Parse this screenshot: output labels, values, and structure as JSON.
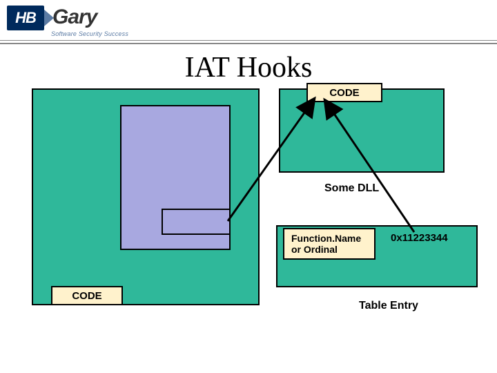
{
  "logo": {
    "hb": "HB",
    "gary": "Gary",
    "tagline": "Software Security Success"
  },
  "title": "IAT Hooks",
  "boxes": {
    "code_top": "CODE",
    "code_bottom": "CODE",
    "some_dll": "Some DLL",
    "func_name": "Function.Name or Ordinal",
    "address": "0x11223344",
    "table_entry": "Table Entry"
  }
}
